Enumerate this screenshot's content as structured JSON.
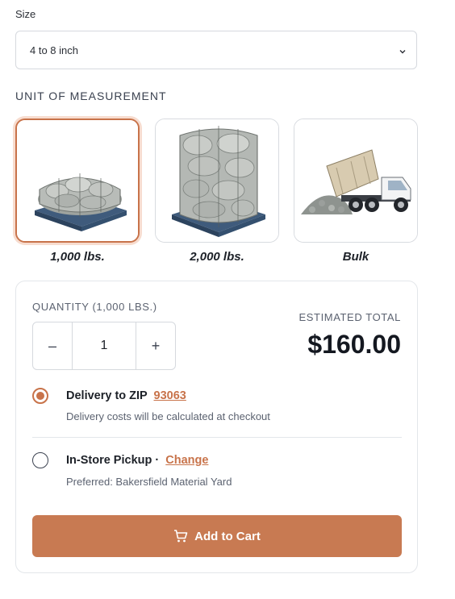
{
  "size": {
    "label": "Size",
    "selected": "4 to 8 inch",
    "chevron_icon": "chevron-down-icon"
  },
  "unit_of_measurement": {
    "title": "UNIT OF MEASUREMENT",
    "options": [
      {
        "label": "1,000 lbs.",
        "image": "small-stone-bag-on-pallet",
        "selected": true
      },
      {
        "label": "2,000 lbs.",
        "image": "tall-stone-bag-on-pallet",
        "selected": false
      },
      {
        "label": "Bulk",
        "image": "dump-truck-unloading-stone",
        "selected": false
      }
    ]
  },
  "quantity": {
    "label": "QUANTITY (1,000 LBS.)",
    "value": "1",
    "decrement": "–",
    "increment": "+"
  },
  "total": {
    "label": "ESTIMATED TOTAL",
    "value": "$160.00"
  },
  "delivery": {
    "title": "Delivery to ZIP",
    "zip": "93063",
    "note": "Delivery costs will be calculated at checkout",
    "selected": true
  },
  "pickup": {
    "title": "In-Store Pickup ·",
    "change_label": "Change",
    "preferred": "Preferred: Bakersfield Material Yard",
    "selected": false
  },
  "cart_button": {
    "label": "Add to Cart",
    "icon": "cart-icon"
  },
  "colors": {
    "accent": "#c8734a",
    "button": "#c87a52"
  }
}
